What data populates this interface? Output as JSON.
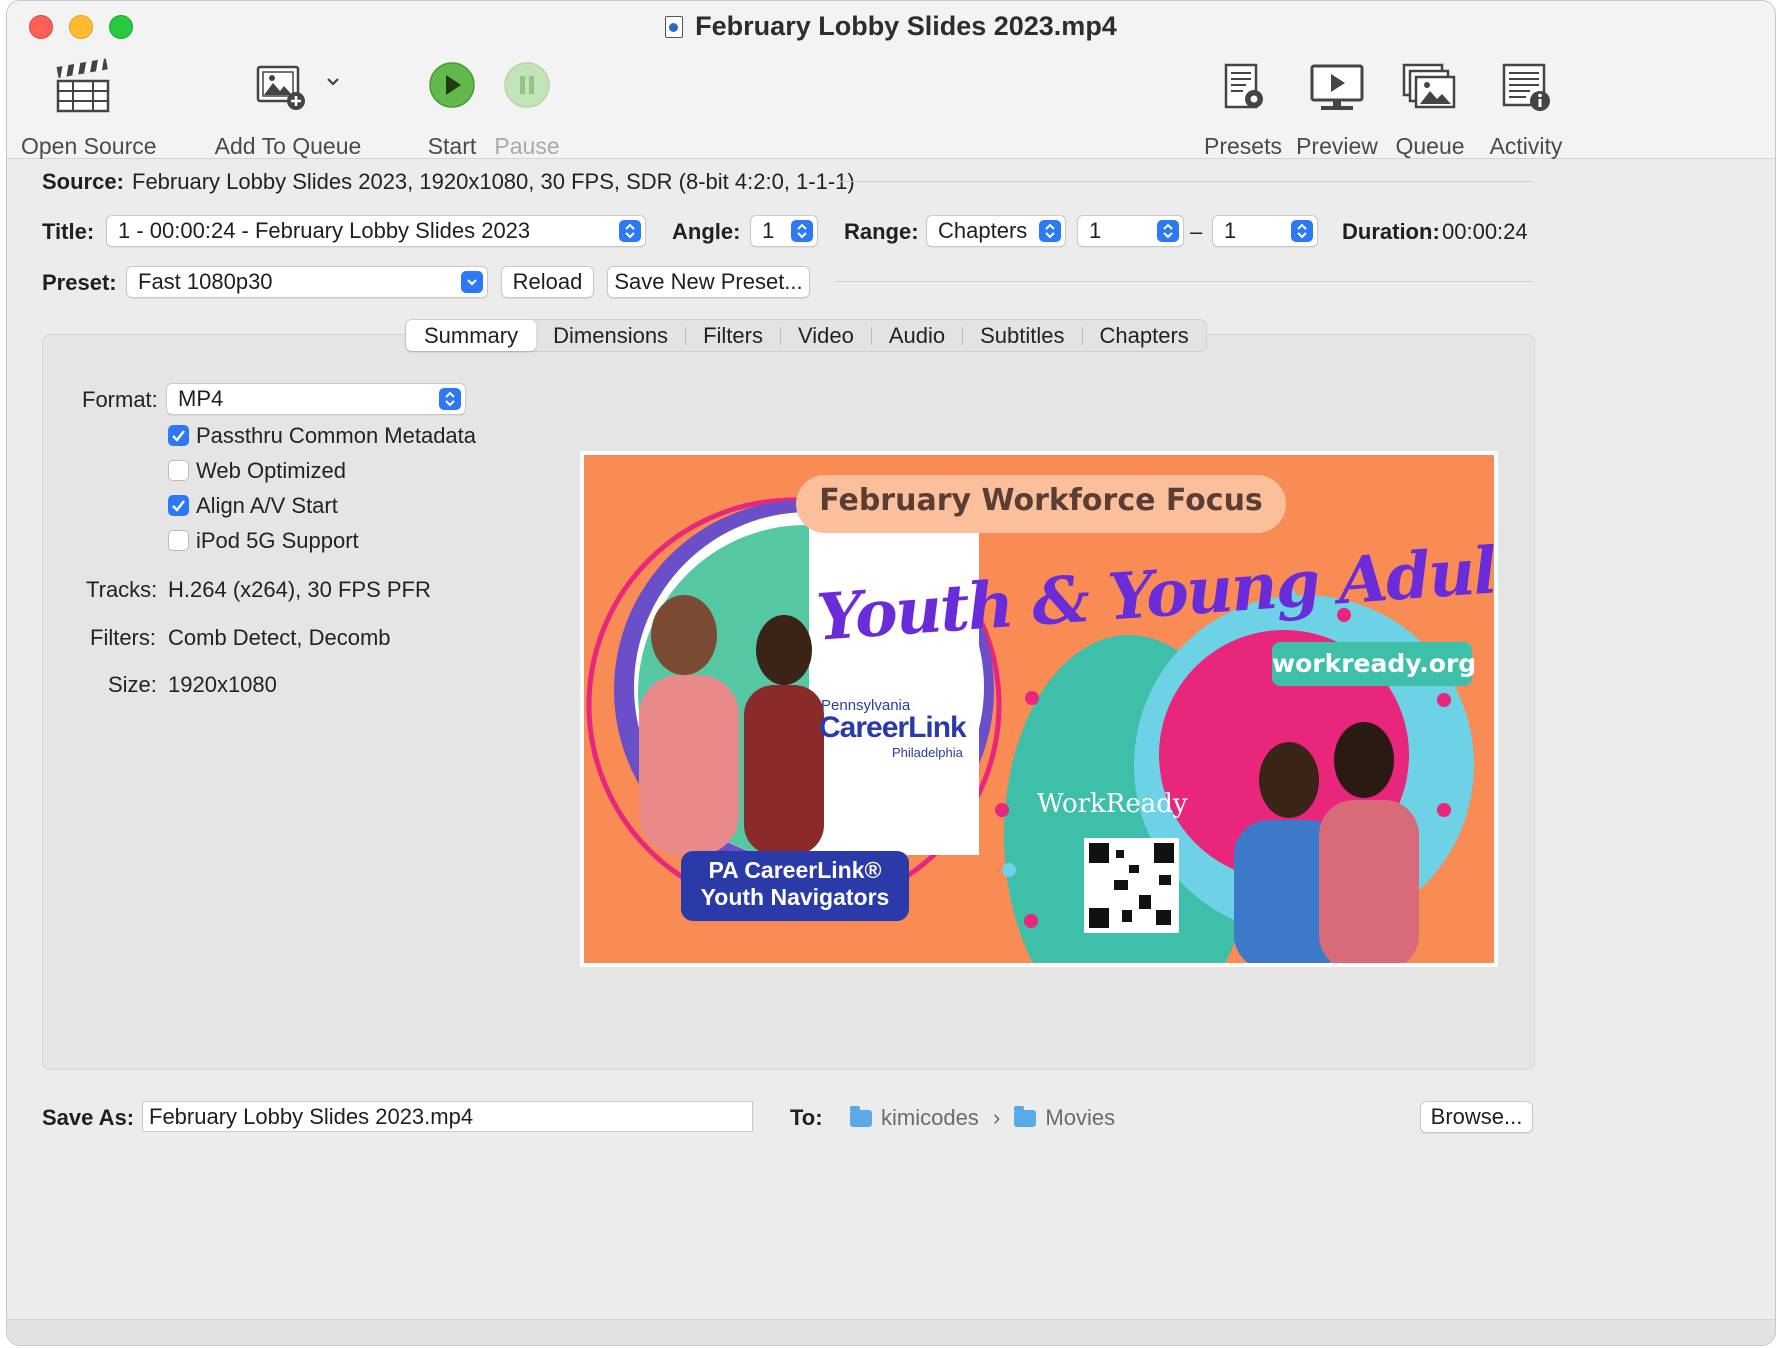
{
  "window": {
    "title": "February Lobby Slides 2023.mp4"
  },
  "toolbar": {
    "open_source": "Open Source",
    "add_to_queue": "Add To Queue",
    "start": "Start",
    "pause": "Pause",
    "presets": "Presets",
    "preview": "Preview",
    "queue": "Queue",
    "activity": "Activity"
  },
  "source": {
    "label": "Source:",
    "value": "February Lobby Slides 2023, 1920x1080, 30 FPS, SDR (8-bit 4:2:0, 1-1-1)"
  },
  "title_row": {
    "title_label": "Title:",
    "title_value": "1 - 00:00:24 - February Lobby Slides 2023",
    "angle_label": "Angle:",
    "angle_value": "1",
    "range_label": "Range:",
    "range_type": "Chapters",
    "range_start": "1",
    "range_dash": "–",
    "range_end": "1",
    "duration_label": "Duration:",
    "duration_value": "00:00:24"
  },
  "preset_row": {
    "label": "Preset:",
    "value": "Fast 1080p30",
    "reload": "Reload",
    "save_new": "Save New Preset..."
  },
  "tabs": [
    "Summary",
    "Dimensions",
    "Filters",
    "Video",
    "Audio",
    "Subtitles",
    "Chapters"
  ],
  "summary": {
    "format_label": "Format:",
    "format_value": "MP4",
    "options": [
      {
        "label": "Passthru Common Metadata",
        "checked": true
      },
      {
        "label": "Web Optimized",
        "checked": false
      },
      {
        "label": "Align A/V Start",
        "checked": true
      },
      {
        "label": "iPod 5G Support",
        "checked": false
      }
    ],
    "tracks_label": "Tracks:",
    "tracks_value": "H.264 (x264), 30 FPS PFR",
    "filters_label": "Filters:",
    "filters_value": "Comb Detect, Decomb",
    "size_label": "Size:",
    "size_value": "1920x1080"
  },
  "preview_image": {
    "banner": "February Workforce Focus",
    "headline": "Youth & Young Adults",
    "url": "workready.org",
    "logo_small": "Pennsylvania",
    "logo_main": "CareerLink",
    "logo_city": "Philadelphia",
    "workready": "WorkReady",
    "badge_line1": "PA CareerLink®",
    "badge_line2": "Youth Navigators"
  },
  "save": {
    "label": "Save As:",
    "filename": "February Lobby Slides 2023.mp4",
    "to_label": "To:",
    "path_home": "kimicodes",
    "path_sep": "›",
    "path_folder": "Movies",
    "browse": "Browse..."
  },
  "colors": {
    "accent": "#2c78f5",
    "preview_orange": "#f98b55",
    "preview_teal": "#3dbfa9",
    "preview_purple": "#6a2bd9",
    "preview_pink": "#e8267c",
    "badge_navy": "#2a3aa8"
  }
}
